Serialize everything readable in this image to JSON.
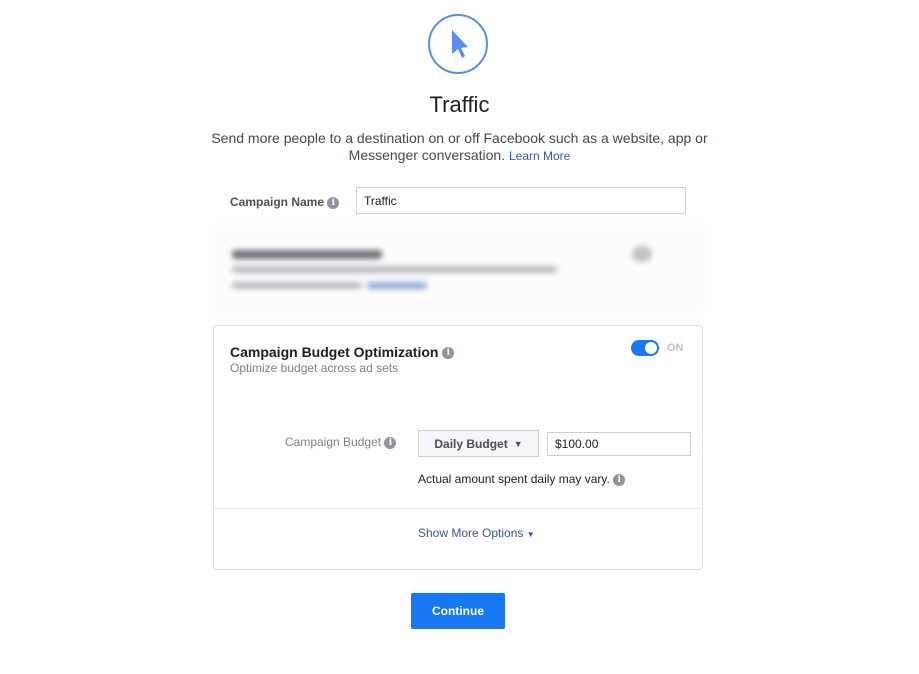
{
  "header": {
    "title": "Traffic",
    "description": "Send more people to a destination on or off Facebook such as a website, app or Messenger conversation.",
    "learn_more": "Learn More"
  },
  "campaign_name": {
    "label": "Campaign Name",
    "value": "Traffic"
  },
  "cbo": {
    "title": "Campaign Budget Optimization",
    "subtitle": "Optimize budget across ad sets",
    "toggle_state": "ON",
    "toggle_on": true,
    "budget_label": "Campaign Budget",
    "budget_type": "Daily Budget",
    "budget_value": "$100.00",
    "note": "Actual amount spent daily may vary.",
    "show_more": "Show More Options"
  },
  "continue_label": "Continue",
  "colors": {
    "accent": "#1877f2",
    "link": "#365899"
  }
}
